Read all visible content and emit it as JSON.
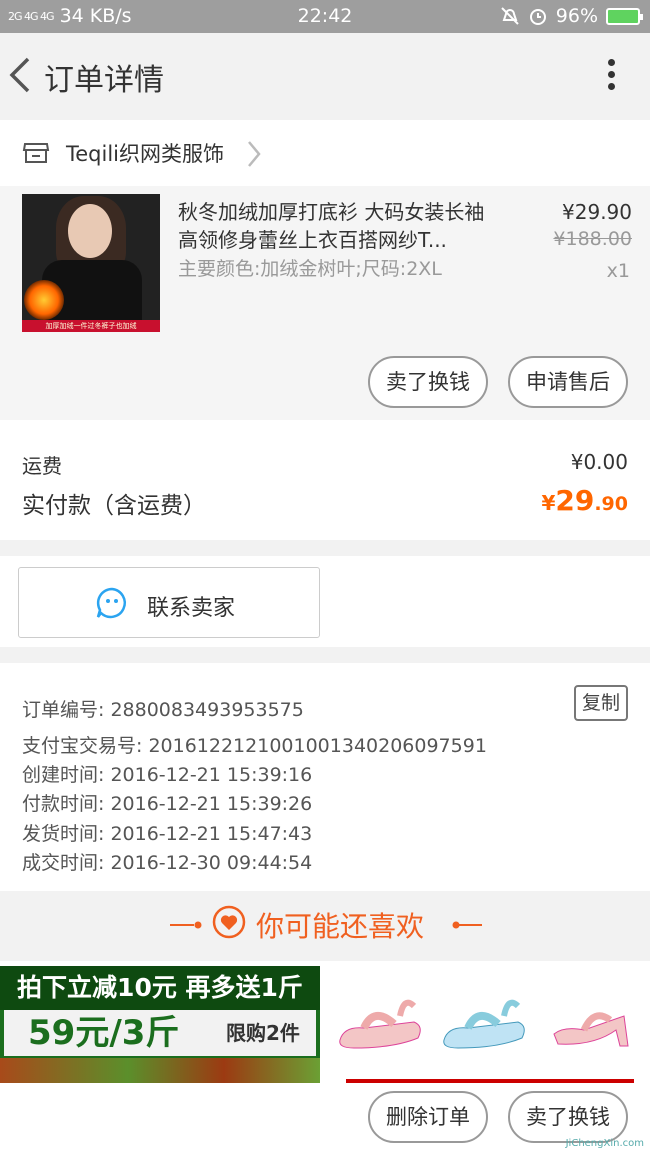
{
  "status_bar": {
    "network": "2G 4G 4G",
    "speed": "34 KB/s",
    "time": "22:42",
    "battery": "96%"
  },
  "header": {
    "title": "订单详情"
  },
  "shop": {
    "name": "Teqili织网类服饰"
  },
  "item": {
    "title": "秋冬加绒加厚打底衫 大码女装长袖高领修身蕾丝上衣百搭网纱T...",
    "spec": "主要颜色:加绒金树叶;尺码:2XL",
    "price": "¥29.90",
    "original_price": "¥188.00",
    "quantity": "x1",
    "image_band": "加厚加绒一件过冬裤子也加绒",
    "buttons": {
      "exchange": "卖了换钱",
      "after_sale": "申请售后"
    }
  },
  "fees": {
    "shipping_label": "运费",
    "shipping_value": "¥0.00",
    "paid_label": "实付款（含运费）",
    "paid_currency": "¥",
    "paid_int": "29",
    "paid_dec": ".90"
  },
  "contact": {
    "label": "联系卖家"
  },
  "order_info": {
    "order_no": "订单编号: 2880083493953575",
    "copy": "复制",
    "alipay_no": "支付宝交易号: 2016122121001001340206097591",
    "created": "创建时间: 2016-12-21 15:39:16",
    "paid": "付款时间: 2016-12-21 15:39:26",
    "shipped": "发货时间: 2016-12-21 15:47:43",
    "completed": "成交时间: 2016-12-30 09:44:54"
  },
  "recommend": {
    "title": "你可能还喜欢"
  },
  "promo": {
    "line1": "拍下立减10元 再多送1斤",
    "line2_big": "59元/3斤",
    "line2_small": "限购2件"
  },
  "bottom": {
    "delete": "删除订单",
    "exchange": "卖了换钱"
  },
  "watermark": "JiChengXin.com",
  "colors": {
    "accent": "#ff6600",
    "recommend": "#f06020",
    "chat_icon": "#2ba4f0"
  }
}
